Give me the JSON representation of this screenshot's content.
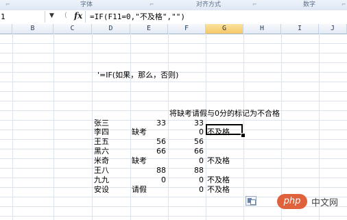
{
  "ribbon": {
    "groups": [
      "字体",
      "对齐方式",
      "数字"
    ]
  },
  "formula_bar": {
    "name_box": "1",
    "fx_label": "fx",
    "formula": "=IF(F11=0,\"不及格\",\"\")"
  },
  "columns": [
    "B",
    "C",
    "D",
    "E",
    "F",
    "G",
    "H",
    "I",
    "J"
  ],
  "active_column": "G",
  "sheet": {
    "note": "'=IF(如果，那么，否则)",
    "header": "将缺考请假与0分的标记为不合格",
    "rows": [
      {
        "name": "张三",
        "remark": "",
        "score": "33",
        "f": "33",
        "g": ""
      },
      {
        "name": "李四",
        "remark": "缺考",
        "score": "",
        "f": "0",
        "g": "不及格"
      },
      {
        "name": "王五",
        "remark": "",
        "score": "56",
        "f": "56",
        "g": ""
      },
      {
        "name": "黑六",
        "remark": "",
        "score": "66",
        "f": "66",
        "g": ""
      },
      {
        "name": "米奇",
        "remark": "缺考",
        "score": "",
        "f": "0",
        "g": "不及格"
      },
      {
        "name": "王八",
        "remark": "",
        "score": "88",
        "f": "88",
        "g": ""
      },
      {
        "name": "九九",
        "remark": "",
        "score": "0",
        "f": "0",
        "g": "不及格"
      },
      {
        "name": "安设",
        "remark": "请假",
        "score": "",
        "f": "0",
        "g": "不及格"
      }
    ]
  },
  "watermark": {
    "badge": "php",
    "text": "中文网"
  }
}
